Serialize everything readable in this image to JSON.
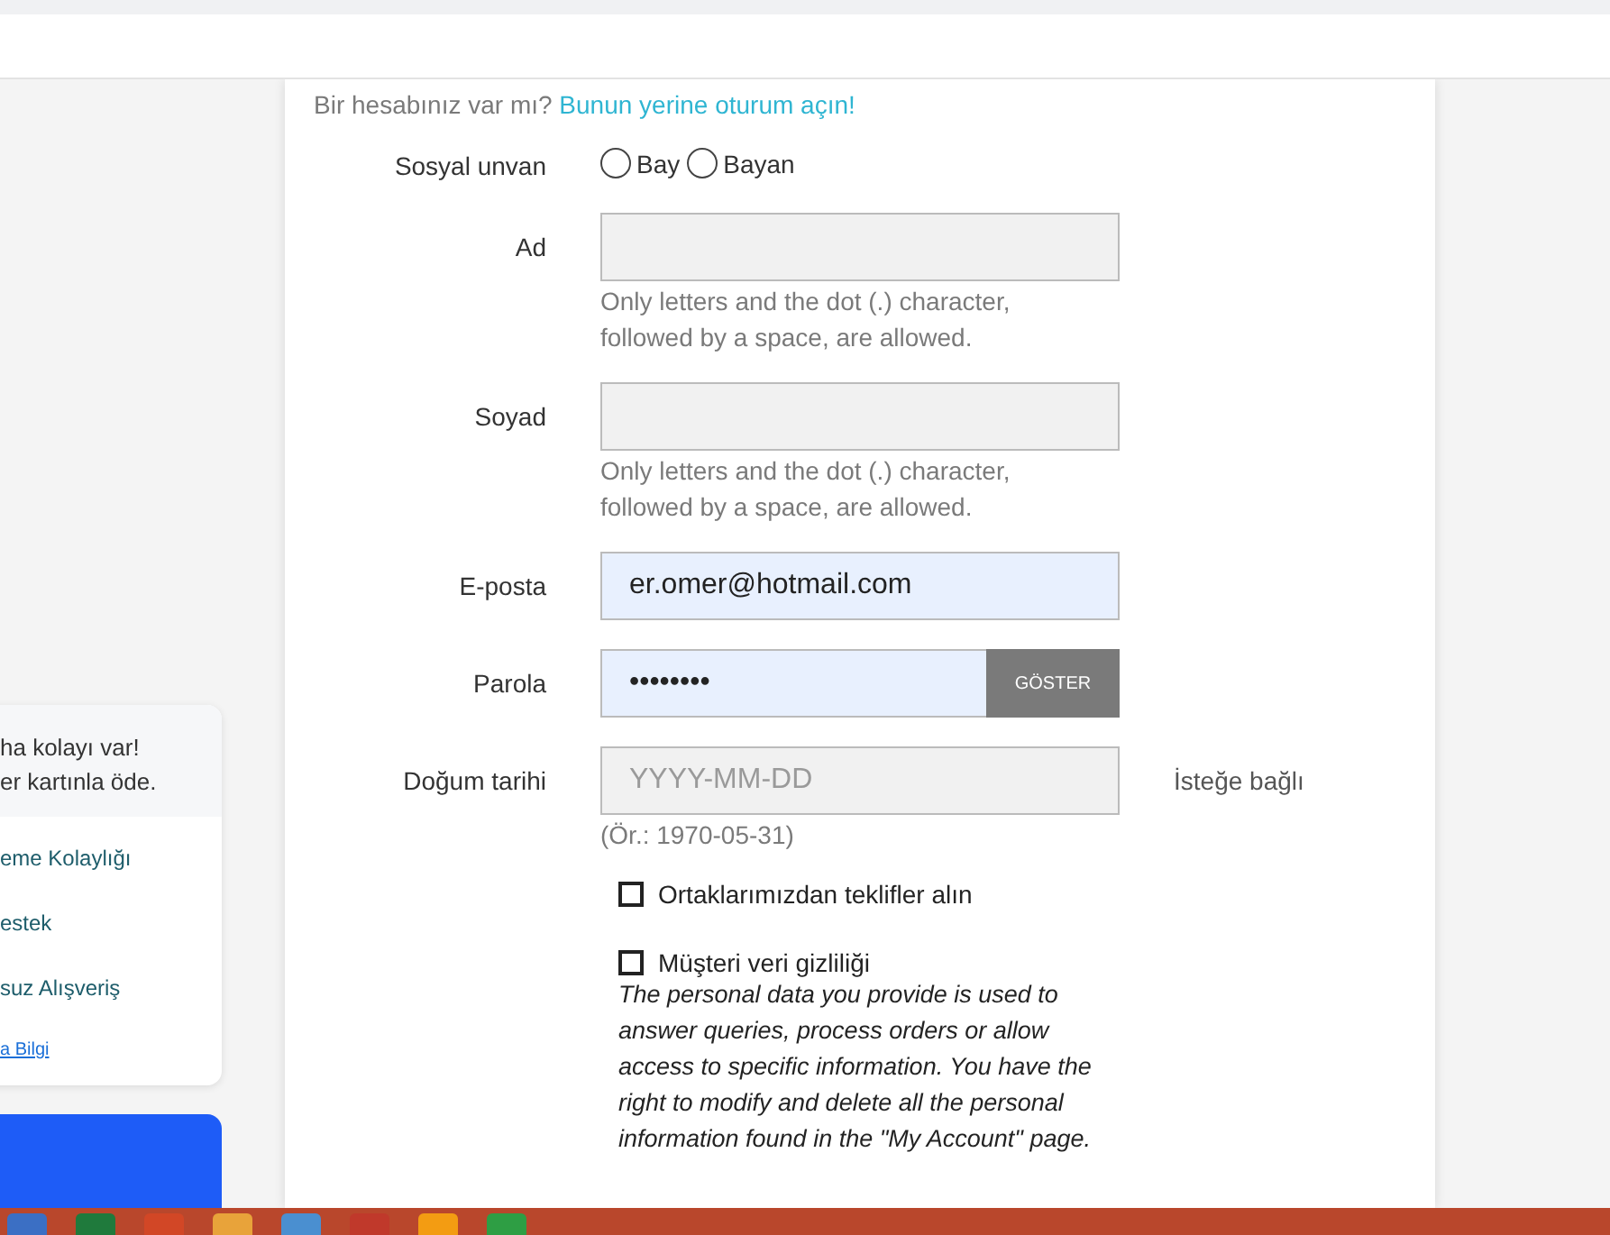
{
  "intro": {
    "text": "Bir hesabınız var mı?",
    "link": "Bunun yerine oturum açın!"
  },
  "title_field": {
    "label": "Sosyal unvan",
    "options": [
      {
        "label": "Bay",
        "selected": false
      },
      {
        "label": "Bayan",
        "selected": false
      }
    ]
  },
  "fields": [
    {
      "kind": "text",
      "label": "Ad",
      "help": "Only letters and the dot (.) character, followed by a space, are allowed."
    },
    {
      "kind": "text",
      "label": "Soyad",
      "help": "Only letters and the dot (.) character, followed by a space, are allowed."
    },
    {
      "kind": "email",
      "label": "E-posta",
      "value": "er.omer@hotmail.com"
    },
    {
      "kind": "password",
      "label": "Parola",
      "value": "••••••••",
      "button": "GÖSTER"
    },
    {
      "kind": "date",
      "label": "Doğum tarihi",
      "placeholder": "YYYY-MM-DD",
      "optional": "İsteğe bağlı",
      "example": "(Ör.: 1970-05-31)"
    }
  ],
  "checkboxes": [
    {
      "label": "Ortaklarımızdan teklifler alın",
      "checked": false
    },
    {
      "label": "Müşteri veri gizliliği",
      "checked": false,
      "note": "The personal data you provide is used to answer queries, process orders or allow access to specific information. You have the right to modify and delete all the personal information found in the \"My Account\" page."
    }
  ],
  "side_card": {
    "heading": [
      "ha kolayı var!",
      "er kartınla öde."
    ],
    "links": [
      "eme Kolaylığı",
      "estek",
      "suz Alışveriş"
    ],
    "more": "a Bilgi"
  }
}
